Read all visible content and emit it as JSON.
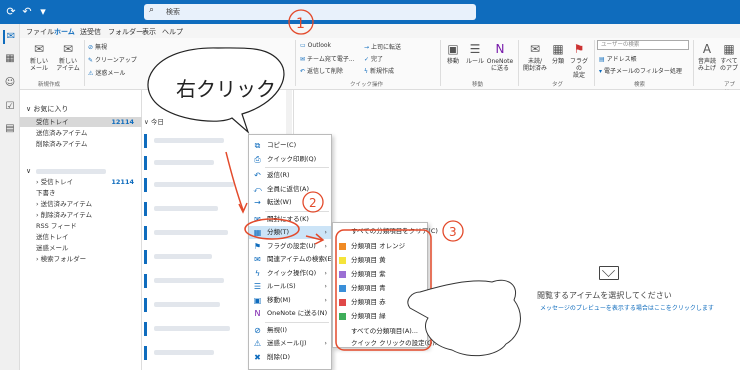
{
  "search": {
    "placeholder": "検索"
  },
  "menu_tabs": [
    "ファイル",
    "ホーム",
    "送受信",
    "フォルダー",
    "表示",
    "ヘルプ"
  ],
  "ribbon": {
    "new_mail": "新しい\nメール",
    "new_item": "新しい\nアイテム",
    "new_group": "新規作成",
    "ignore": "無視",
    "cleanup": "クリーンアップ",
    "junk": "迷惑メール",
    "quick_steps": [
      "Outlook",
      "チーム宛て電子...",
      "返信して削除"
    ],
    "quick_steps2": [
      "上司に転送",
      "完了",
      "新規作成"
    ],
    "quick_group": "クイック操作",
    "move": "移動",
    "rules": "ルール",
    "onenote": "OneNote\nに送る",
    "move_group": "移動",
    "unread": "未読/\n開封済み",
    "categorize": "分類",
    "followup": "フラグの\n設定",
    "tags_group": "タグ",
    "people_search": "ユーザーの検索",
    "address_book": "アドレス帳",
    "filter_mail": "電子メールのフィルター処理",
    "find_group": "検索",
    "read_aloud": "音声読\nみ上げ",
    "apps_label": "すべて\nのアプ",
    "apps_group": "アプリ"
  },
  "folders": {
    "favorites_header": "お気に入り",
    "favorites": [
      {
        "label": "受信トレイ",
        "count": "12114"
      },
      {
        "label": "送信済みアイテム",
        "count": ""
      },
      {
        "label": "削除済みアイテム",
        "count": ""
      }
    ],
    "account_items": [
      {
        "label": "受信トレイ",
        "count": "12114"
      },
      {
        "label": "下書き",
        "count": ""
      },
      {
        "label": "送信済みアイテム",
        "count": ""
      },
      {
        "label": "削除済みアイテム",
        "count": ""
      },
      {
        "label": "RSS フィード",
        "count": ""
      },
      {
        "label": "送信トレイ",
        "count": ""
      },
      {
        "label": "迷惑メール",
        "count": ""
      },
      {
        "label": "検索フォルダー",
        "count": ""
      }
    ]
  },
  "mail_list": {
    "group_header": "今日"
  },
  "reading_pane": {
    "title": "閲覧するアイテムを選択してください",
    "subtitle": "メッセージのプレビューを表示する場合はここをクリックします"
  },
  "context_menu": [
    {
      "label": "コピー(C)",
      "icon": "copy-icon",
      "arrow": false
    },
    {
      "label": "クイック印刷(Q)",
      "icon": "print-icon",
      "arrow": false
    },
    {
      "label": "返信(R)",
      "icon": "reply-icon",
      "arrow": false
    },
    {
      "label": "全員に返信(A)",
      "icon": "reply-all-icon",
      "arrow": false
    },
    {
      "label": "転送(W)",
      "icon": "forward-icon",
      "arrow": false
    },
    {
      "label": "開封にする(K)",
      "icon": "read-icon",
      "arrow": false
    },
    {
      "label": "分類(T)",
      "icon": "categorize-icon",
      "arrow": true
    },
    {
      "label": "フラグの設定(U)",
      "icon": "flag-icon",
      "arrow": true
    },
    {
      "label": "関連アイテムの検索(E)",
      "icon": "find-related-icon",
      "arrow": true
    },
    {
      "label": "クイック操作(Q)",
      "icon": "quick-steps-icon",
      "arrow": true
    },
    {
      "label": "ルール(S)",
      "icon": "rules-icon",
      "arrow": true
    },
    {
      "label": "移動(M)",
      "icon": "move-icon",
      "arrow": true
    },
    {
      "label": "OneNote に送る(N)",
      "icon": "onenote-icon",
      "arrow": false
    },
    {
      "label": "無視(I)",
      "icon": "ignore-icon",
      "arrow": false
    },
    {
      "label": "迷惑メール(J)",
      "icon": "junk-icon",
      "arrow": true
    },
    {
      "label": "削除(D)",
      "icon": "delete-icon",
      "arrow": false
    }
  ],
  "category_submenu": {
    "clear_all": "すべての分類項目をクリア(C)",
    "items": [
      {
        "label": "分類項目 オレンジ",
        "color": "#f08a24"
      },
      {
        "label": "分類項目 黄",
        "color": "#f5e43a"
      },
      {
        "label": "分類項目 紫",
        "color": "#9b6fd4"
      },
      {
        "label": "分類項目 青",
        "color": "#3a8fd9"
      },
      {
        "label": "分類項目 赤",
        "color": "#e04848"
      },
      {
        "label": "分類項目 緑",
        "color": "#3fae5a"
      }
    ],
    "all_categories": "すべての分類項目(A)...",
    "quick_click": "クイック クリックの設定(Q)..."
  },
  "annotations": {
    "speech_bubble": "右クリック",
    "step1": "①",
    "step2": "②",
    "step3": "③",
    "accent_color": "#e34a2b"
  },
  "colors": {
    "brand": "#0f6cbd",
    "highlight": "#cce4f7"
  }
}
